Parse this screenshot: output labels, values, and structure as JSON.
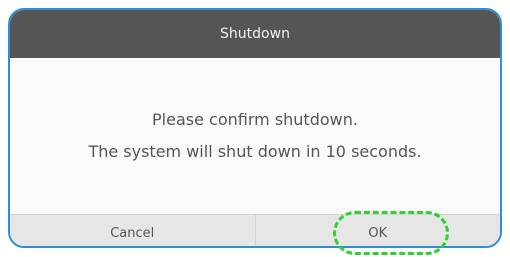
{
  "dialog": {
    "title": "Shutdown",
    "message_line1": "Please confirm shutdown.",
    "message_line2": "The system will shut down in 10 seconds."
  },
  "buttons": {
    "cancel_label": "Cancel",
    "ok_label": "OK"
  },
  "colors": {
    "accent_border": "#2f8fd6",
    "highlight": "#2ed12e",
    "title_bar": "#555555"
  }
}
